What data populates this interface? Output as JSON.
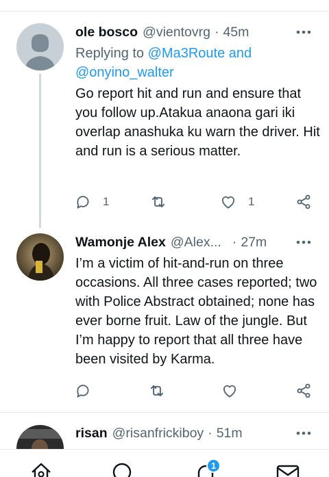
{
  "tweets": [
    {
      "name": "ole bosco",
      "handle": "@vientovrg",
      "separator": "·",
      "time": "45m",
      "replying_prefix": "Replying to ",
      "replying_mention1": "@Ma3Route",
      "replying_and": " and",
      "replying_mention2": "@onyino_walter",
      "body": "Go report hit and run and ensure that you follow up.Atakua anaona gari iki overlap anashuka ku warn the driver. Hit and run is a serious matter.",
      "reply_count": "1",
      "retweet_count": "",
      "like_count": "1"
    },
    {
      "name": "Wamonje Alex",
      "handle": "@Alex...",
      "separator": "·",
      "time": "27m",
      "body": "I’m a victim of hit-and-run on three occasions. All three cases reported; two with Police Abstract obtained; none has ever borne fruit. Law of the jungle. But I’m happy to report that all three have been visited by Karma.",
      "reply_count": "",
      "retweet_count": "",
      "like_count": ""
    },
    {
      "name": "risan",
      "handle": "@risanfrickiboy",
      "separator": "·",
      "time": "51m"
    }
  ],
  "nav": {
    "items": [
      "home-icon",
      "search-icon",
      "notifications-icon",
      "messages-icon"
    ],
    "notifications_badge": "1"
  },
  "colors": {
    "accent": "#1d9bf0",
    "text": "#0f1419",
    "muted": "#536471",
    "divider": "#e6e9ec"
  }
}
